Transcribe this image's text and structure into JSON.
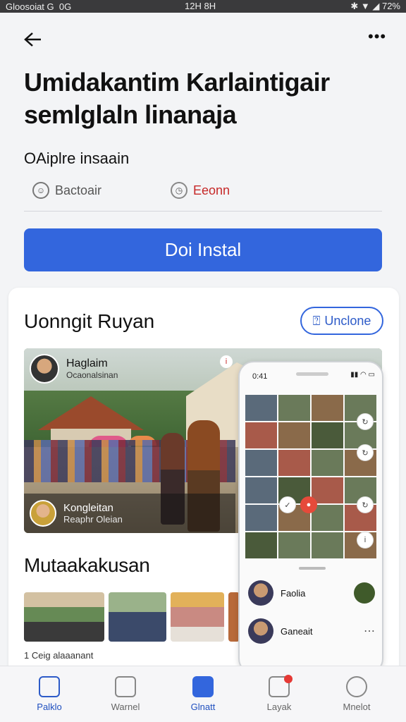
{
  "status_bar": {
    "left": "Gloosoiat G",
    "left2": "0G",
    "time": "12H 8H",
    "right": "72%"
  },
  "header": {
    "title_line1": "Umidakantim Karlaintigair",
    "title_line2": "semlglaln linanaja",
    "subtitle": "OAiplre insaain",
    "action_left": "Bactoair",
    "action_right": "Eeonn",
    "install_label": "Doi Instal"
  },
  "card": {
    "title": "Uonngit Ruyan",
    "unclose_label": "Unclone",
    "photo": {
      "top_name": "Haglaim",
      "top_sub": "Ocaonalsinan",
      "bottom_name": "Kongleitan",
      "bottom_sub": "Reaphr Oleian",
      "pin": "i"
    },
    "phone": {
      "time": "0:41",
      "rows": [
        {
          "name": "Faolia"
        },
        {
          "name": "Ganeait"
        }
      ]
    },
    "section2_title": "Mutaakakusan",
    "footer": "1 Ceig alaaanant"
  },
  "nav": {
    "items": [
      {
        "label": "Palklo"
      },
      {
        "label": "Warnel"
      },
      {
        "label": "Glnatt"
      },
      {
        "label": "Layak"
      },
      {
        "label": "Mnelot"
      }
    ]
  },
  "colors": {
    "accent": "#3366DD",
    "danger": "#C62828"
  }
}
